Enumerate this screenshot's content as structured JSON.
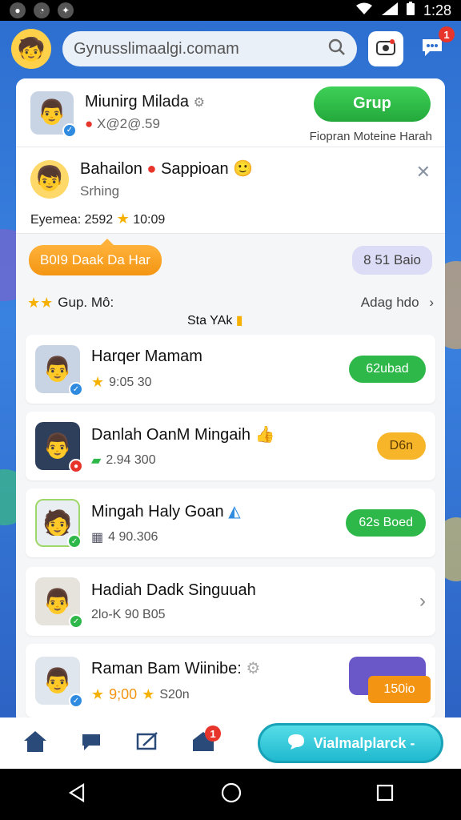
{
  "status_bar": {
    "time": "1:28"
  },
  "search": {
    "value": "Gynusslimaalgi.comam"
  },
  "topbar": {
    "chat_badge": "1"
  },
  "profile": {
    "name": "Miunirg Milada",
    "sub": "X@2@.59",
    "group_button": "Grup",
    "group_caption": "Fiopran Moteine Harah"
  },
  "friend": {
    "name": "Bahailon",
    "name2": "Sappioan",
    "sub": "Srhing",
    "info_label": "Eyemea:",
    "info_value": "2592",
    "info_time": "10:09"
  },
  "chips": {
    "orange": "B0I9 Daak Da Har",
    "purple": "8 51 Baio"
  },
  "list": {
    "title": "Gup. Mô:",
    "more": "Adag hdo",
    "overlay": "Sta YAk"
  },
  "items": [
    {
      "name": "Harqer Mamam",
      "meta": "9:05 30",
      "action": "62ubad"
    },
    {
      "name": "Danlah OanM Mingaih",
      "meta": "2.94 300",
      "action": "D6n"
    },
    {
      "name": "Mingah Haly Goan",
      "meta": "4 90.306",
      "action": "62s Boed"
    },
    {
      "name": "Hadiah Dadk Singuuah",
      "meta": "2lo-K 90 B05"
    },
    {
      "name": "Raman Bam Wiinibe:",
      "meta": "9;00",
      "meta2": "S20n",
      "action": "150io"
    }
  ],
  "bottom": {
    "cta": "Vialmalplarck -",
    "home_badge": "1"
  }
}
